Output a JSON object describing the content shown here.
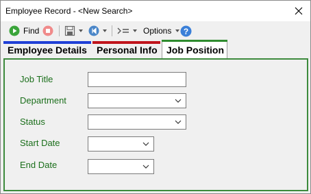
{
  "window": {
    "title": "Employee Record - <New Search>"
  },
  "toolbar": {
    "find_label": "Find",
    "options_label": "Options"
  },
  "tabs": [
    {
      "label": "Employee Details",
      "accent": "#1f3fd6"
    },
    {
      "label": "Personal Info",
      "accent": "#c0141c"
    },
    {
      "label": "Job Position",
      "accent": "#2e8b2e"
    }
  ],
  "form": {
    "job_title_label": "Job Title",
    "department_label": "Department",
    "status_label": "Status",
    "start_date_label": "Start Date",
    "end_date_label": "End Date",
    "job_title_value": "",
    "department_value": "",
    "status_value": "",
    "start_date_value": "",
    "end_date_value": ""
  },
  "colors": {
    "label_green": "#1a6e1a",
    "panel_border": "#3c8a3c"
  }
}
